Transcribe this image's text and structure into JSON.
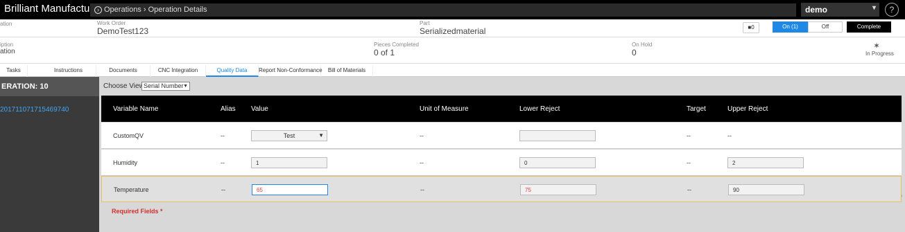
{
  "app": {
    "title": "Brilliant Manufacturing"
  },
  "breadcrumb": {
    "icon": "circle-arrow-icon",
    "text": "Operations",
    "separator": "›",
    "current": "Operation Details"
  },
  "user": {
    "name": "demo",
    "chevron": "chevron-down-icon",
    "help": "?"
  },
  "header": {
    "left_label_1": "ation",
    "work_order_label": "Work Order",
    "work_order_value": "DemoTest123",
    "part_label": "Part",
    "part_value": "Serializedmaterial",
    "comments_count": "0",
    "toggle_on": "On (1)",
    "toggle_off": "Off",
    "complete": "Complete",
    "left_label_2": "iption",
    "left_value_2": "ation",
    "pieces_label": "Pieces Completed",
    "pieces_value": "0 of 1",
    "onhold_label": "On Hold",
    "onhold_value": "0",
    "status": "In Progress"
  },
  "tabs": [
    {
      "label": "Tasks"
    },
    {
      "label": "Instructions"
    },
    {
      "label": "Documents"
    },
    {
      "label": "CNC Integration"
    },
    {
      "label": "Quality Data",
      "active": true
    },
    {
      "label": "Report Non-Conformance"
    },
    {
      "label": "Bill of Materials"
    }
  ],
  "leftpanel": {
    "operation": "ERATION: 10",
    "serial": "201711071715469740"
  },
  "main": {
    "choose_view_label": "Choose View",
    "choose_view_value": "Serial Number",
    "columns": [
      "Variable Name",
      "Alias",
      "Value",
      "Unit of Measure",
      "Lower Reject",
      "Target",
      "Upper Reject"
    ],
    "rows": [
      {
        "name": "CustomQV",
        "alias": "--",
        "value": "Test",
        "uom": "--",
        "lower": "",
        "target": "--",
        "upper": "--"
      },
      {
        "name": "Humidity",
        "alias": "--",
        "value": "1",
        "uom": "--",
        "lower": "0",
        "target": "--",
        "upper": "2"
      },
      {
        "name": "Temperature",
        "alias": "--",
        "value": "65",
        "uom": "--",
        "lower": "75",
        "target": "--",
        "upper": "90"
      }
    ],
    "required": "Required Fields *"
  },
  "colors": {
    "accent": "#1e88e5",
    "error": "#e53935",
    "header_bg": "#000000"
  }
}
